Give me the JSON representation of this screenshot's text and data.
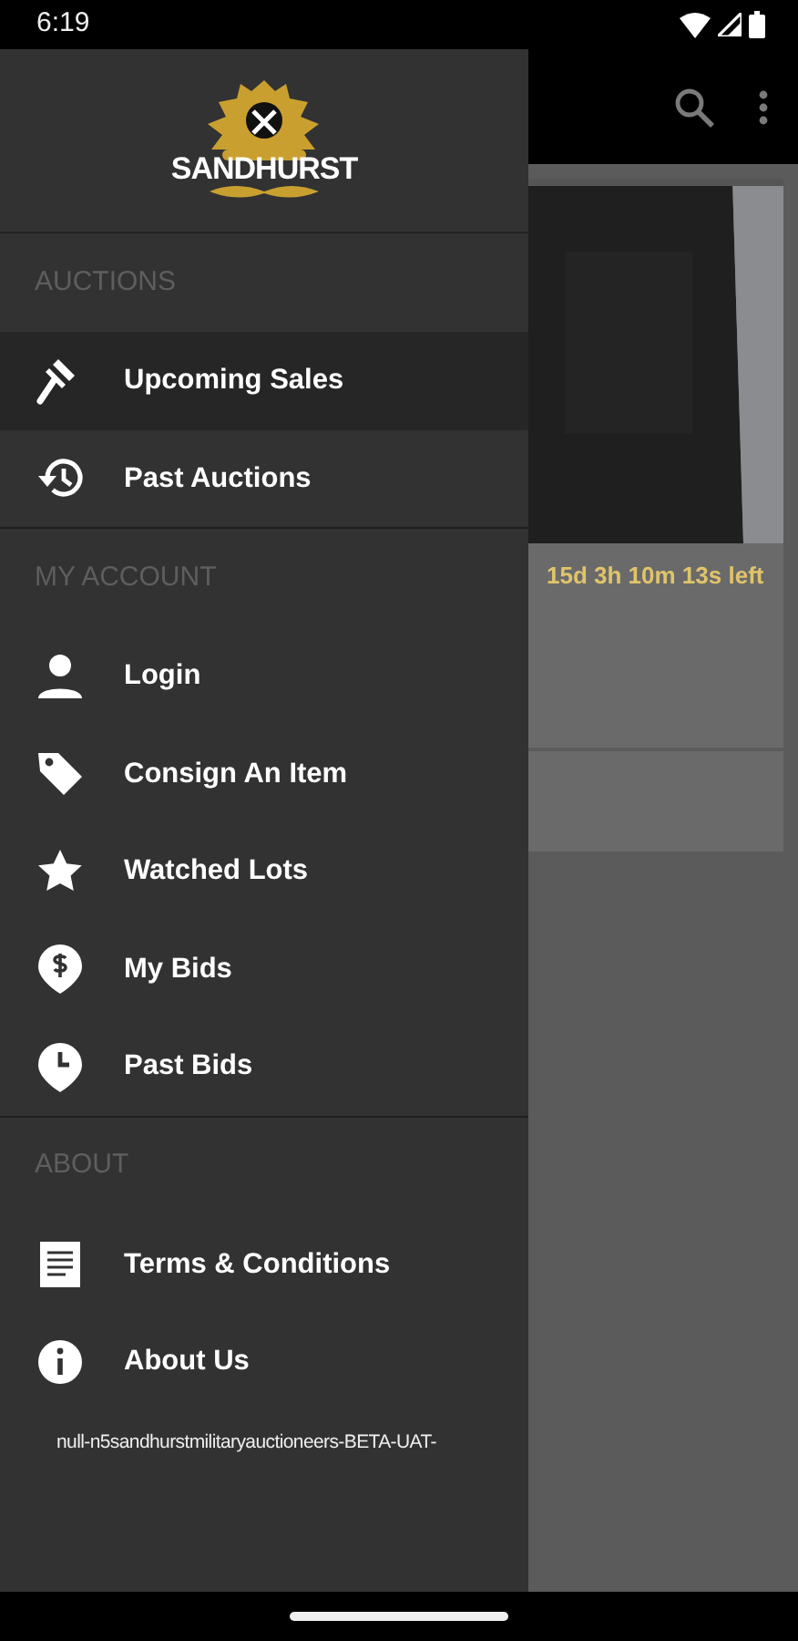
{
  "status_bar": {
    "time": "6:19"
  },
  "drawer": {
    "logo": {
      "name": "SANDHURST"
    },
    "sections": [
      {
        "title": "AUCTIONS",
        "items": [
          {
            "label": "Upcoming Sales",
            "selected": true
          },
          {
            "label": "Past Auctions",
            "selected": false
          }
        ]
      },
      {
        "title": "MY ACCOUNT",
        "items": [
          {
            "label": "Login",
            "selected": false
          },
          {
            "label": "Consign An Item",
            "selected": false
          },
          {
            "label": "Watched Lots",
            "selected": false
          },
          {
            "label": "My Bids",
            "selected": false
          },
          {
            "label": "Past Bids",
            "selected": false
          }
        ]
      },
      {
        "title": "ABOUT",
        "items": [
          {
            "label": "Terms & Conditions",
            "selected": false
          },
          {
            "label": "About Us",
            "selected": false
          }
        ]
      }
    ],
    "version": "null-n5sandhurstmilitaryauctioneers-BETA-UAT-"
  },
  "background": {
    "lot": {
      "kind": "picture",
      "time_left": "15d 3h 10m 13s left"
    }
  }
}
